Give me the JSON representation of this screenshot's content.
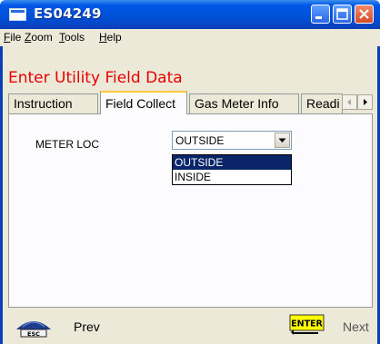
{
  "window": {
    "title": "ES04249"
  },
  "menu": [
    {
      "mnemonic": "F",
      "rest": "ile"
    },
    {
      "mnemonic": "Z",
      "rest": "oom"
    },
    {
      "mnemonic": "T",
      "rest": "ools"
    },
    {
      "mnemonic": "H",
      "rest": "elp"
    }
  ],
  "page": {
    "title": "Enter Utility Field Data"
  },
  "tabs": [
    {
      "label": "Instruction",
      "active": false
    },
    {
      "label": "Field Collect",
      "active": true
    },
    {
      "label": "Gas Meter Info",
      "active": false
    },
    {
      "label": "Readi",
      "active": false
    }
  ],
  "form": {
    "meter_loc_label": "METER LOC",
    "meter_loc_value": "OUTSIDE",
    "meter_loc_options": [
      {
        "label": "OUTSIDE",
        "selected": true
      },
      {
        "label": "INSIDE",
        "selected": false
      }
    ]
  },
  "footer": {
    "esc_key": "ESC",
    "prev_label": "Prev",
    "enter_key": "ENTER",
    "next_label": "Next"
  },
  "colors": {
    "title_bar": "#0050d8",
    "page_title": "#e80000",
    "selection": "#0a246a",
    "enter_key_bg": "#ffff00"
  }
}
